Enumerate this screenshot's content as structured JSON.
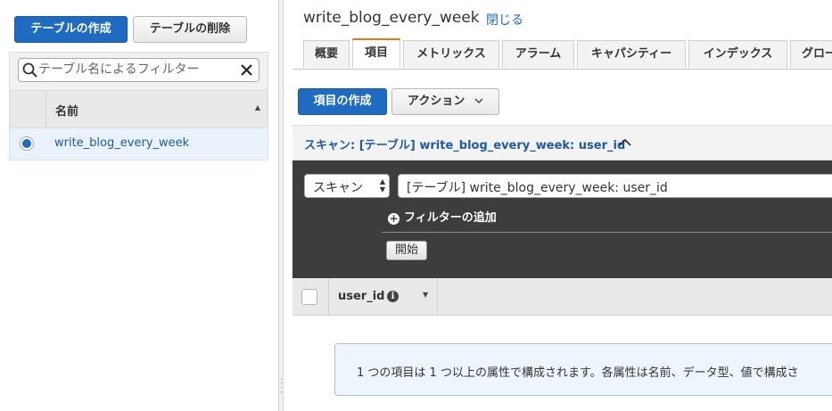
{
  "left": {
    "create_table_label": "テーブルの作成",
    "delete_table_label": "テーブルの削除",
    "filter_placeholder": "テーブル名によるフィルター",
    "column_name": "名前",
    "tables": [
      {
        "name": "write_blog_every_week",
        "selected": true
      }
    ]
  },
  "detail": {
    "title": "write_blog_every_week",
    "close_label": "閉じる",
    "tabs": [
      {
        "label": "概要",
        "active": false
      },
      {
        "label": "項目",
        "active": true
      },
      {
        "label": "メトリックス",
        "active": false
      },
      {
        "label": "アラーム",
        "active": false
      },
      {
        "label": "キャパシティー",
        "active": false
      },
      {
        "label": "インデックス",
        "active": false
      },
      {
        "label": "グロー",
        "active": false
      }
    ],
    "create_item_label": "項目の作成",
    "actions_label": "アクション",
    "scan_header": "スキャン: [テーブル] write_blog_every_week: user_id",
    "mode_value": "スキャン",
    "target_value": "[テーブル] write_blog_every_week: user_id",
    "add_filter_label": "フィルターの追加",
    "start_label": "開始",
    "results_column": "user_id",
    "info_message": "1 つの項目は 1 つ以上の属性で構成されます。各属性は名前、データ型、値で構成さ"
  },
  "colors": {
    "primary": "#1f6bc1",
    "active_tab_accent": "#e47911",
    "link": "#1f5aa6",
    "scan_panel_bg": "#3d3d3d"
  },
  "icons": {
    "search": "search-icon",
    "clear": "close-icon",
    "sort": "sort-asc-icon",
    "chevron_up": "chevron-up-icon",
    "chevron_down": "chevron-down-icon",
    "plus": "plus-circle-icon",
    "info": "info-icon"
  }
}
